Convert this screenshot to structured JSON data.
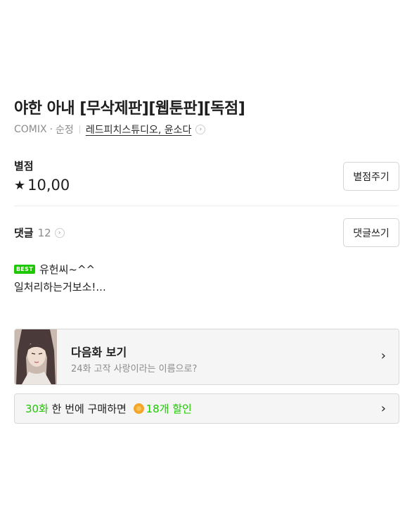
{
  "title": "야한 아내 [무삭제판][웹툰판][독점]",
  "meta": {
    "publisher": "COMIX",
    "dot": "·",
    "genre": "순정",
    "authors": "레드피치스튜디오, 윤소다"
  },
  "rating": {
    "label": "별점",
    "star": "★",
    "value": "10,00",
    "rate_button": "별점주기"
  },
  "comments": {
    "label": "댓글",
    "count": "12",
    "write_button": "댓글쓰기",
    "best": {
      "badge": "BEST",
      "user": "유헌씨~^^",
      "text": "일처리하는거보소!..."
    }
  },
  "next_episode": {
    "title": "다음화 보기",
    "subtitle": "24화 고작 사랑이라는 이름으로?"
  },
  "bundle": {
    "episodes": "30화",
    "text": " 한 번에 구매하면 ",
    "discount": "18개 할인",
    "coin_icon": "cookie-coin-icon"
  },
  "colors": {
    "accent": "#1ec800",
    "coin": "#f4a62a"
  }
}
